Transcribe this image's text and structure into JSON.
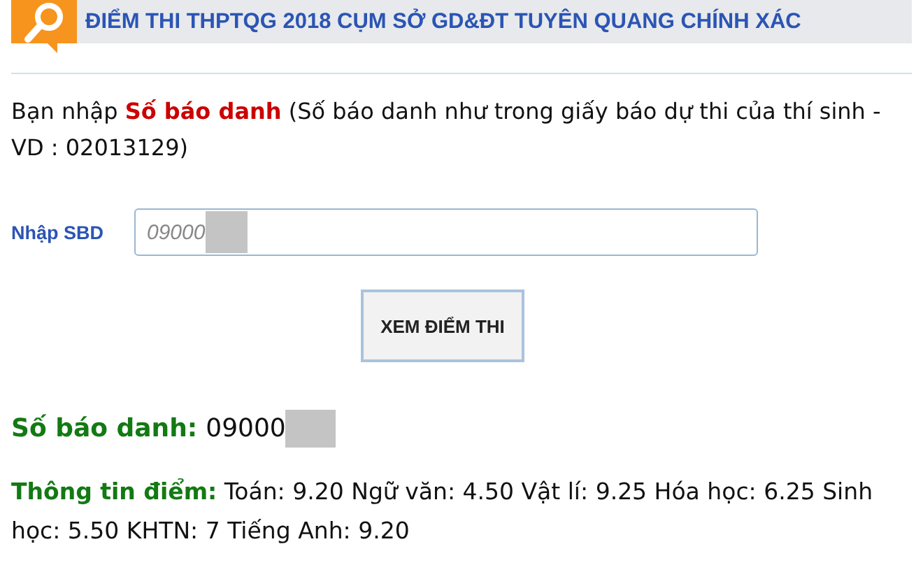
{
  "header": {
    "title": "ĐIỂM THI THPTQG 2018 CỤM SỞ GD&ĐT TUYÊN QUANG CHÍNH XÁC"
  },
  "intro": "Bạn nhập **Số báo danh** (Số báo danh như trong giấy báo dự thi của thí sinh - VD : 02013129)",
  "form": {
    "label": "Nhập SBD",
    "value": "09000",
    "button": "XEM ĐIỂM THI"
  },
  "result": {
    "sbd_label": "Số báo danh:",
    "sbd_value": "09000",
    "scores_label": "Thông tin điểm:",
    "scores": "Toán: 9.20 Ngữ văn: 4.50 Vật lí: 9.25 Hóa học: 6.25 Sinh học: 5.50 KHTN: 7 Tiếng Anh: 9.20"
  }
}
